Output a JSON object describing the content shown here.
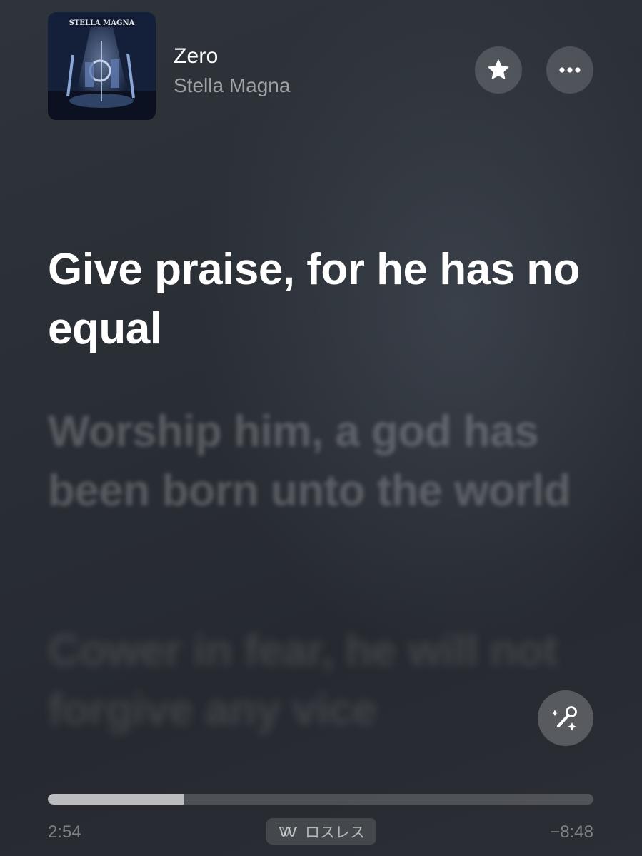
{
  "now_playing": {
    "title": "Zero",
    "artist": "Stella Magna",
    "album_art_text": "STELLA MAGNA"
  },
  "lyrics": {
    "active": "Give praise, for he has no equal",
    "next": [
      "Worship him, a god has been born unto the world",
      "Cower in fear, he will not forgive any vice"
    ]
  },
  "playback": {
    "elapsed": "2:54",
    "remaining": "−8:48",
    "progress": 0.249,
    "quality_label": "ロスレス"
  },
  "icons": {
    "favorite": "star-icon",
    "more": "ellipsis-icon",
    "sing": "microphone-sparkle-icon",
    "lossless": "lossless-wave-icon"
  },
  "colors": {
    "background": "#2a2f36",
    "progress_fill": "#a6a8ab",
    "progress_track": "#4a4f56"
  }
}
